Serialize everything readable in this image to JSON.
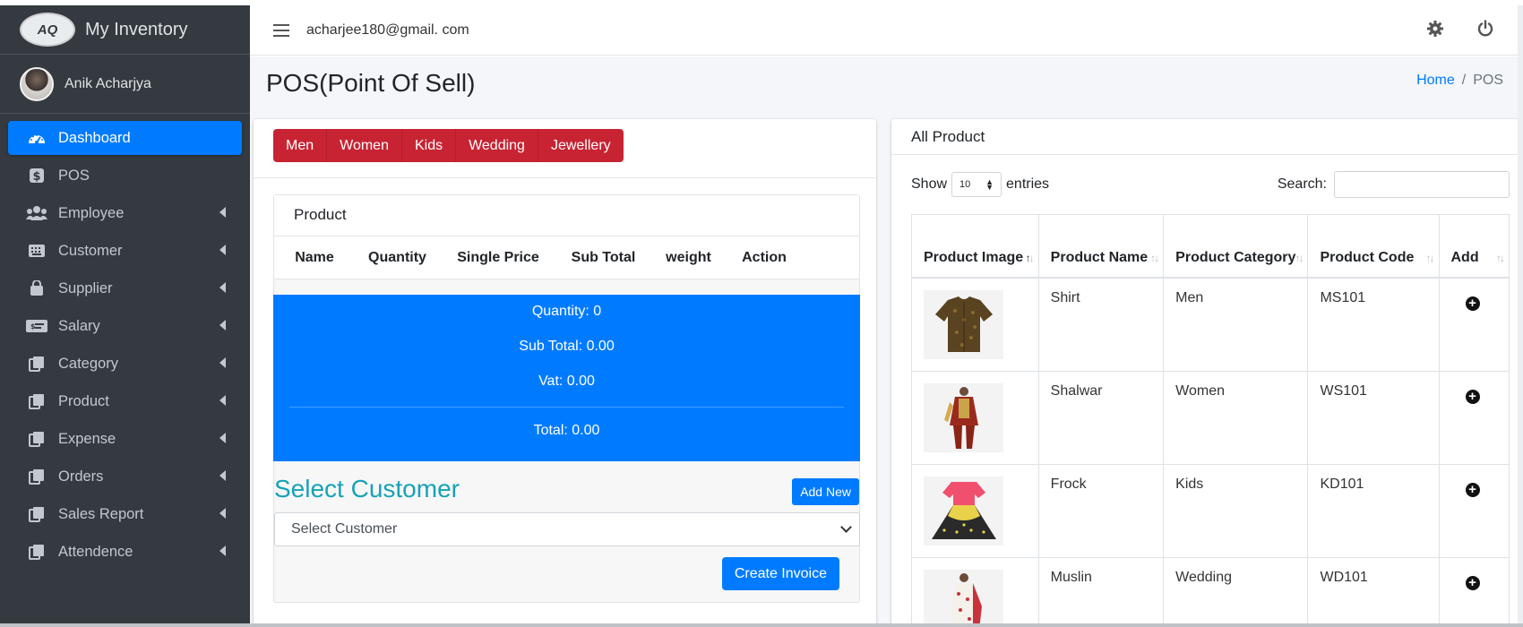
{
  "app": {
    "brand_name": "My Inventory",
    "brand_logo_text": "AQ"
  },
  "user": {
    "name": "Anik Acharjya"
  },
  "sidebar": {
    "items": [
      {
        "label": "Dashboard",
        "icon": "tachometer-icon",
        "active": true,
        "has_caret": false
      },
      {
        "label": "POS",
        "icon": "dollar-icon",
        "active": false,
        "has_caret": false
      },
      {
        "label": "Employee",
        "icon": "users-icon",
        "active": false,
        "has_caret": true
      },
      {
        "label": "Customer",
        "icon": "keyboard-icon",
        "active": false,
        "has_caret": true
      },
      {
        "label": "Supplier",
        "icon": "shopping-bag-icon",
        "active": false,
        "has_caret": true
      },
      {
        "label": "Salary",
        "icon": "money-bill-icon",
        "active": false,
        "has_caret": true
      },
      {
        "label": "Category",
        "icon": "copy-icon",
        "active": false,
        "has_caret": true
      },
      {
        "label": "Product",
        "icon": "copy-icon",
        "active": false,
        "has_caret": true
      },
      {
        "label": "Expense",
        "icon": "copy-icon",
        "active": false,
        "has_caret": true
      },
      {
        "label": "Orders",
        "icon": "copy-icon",
        "active": false,
        "has_caret": true
      },
      {
        "label": "Sales Report",
        "icon": "copy-icon",
        "active": false,
        "has_caret": true
      },
      {
        "label": "Attendence",
        "icon": "copy-icon",
        "active": false,
        "has_caret": true
      }
    ]
  },
  "topbar": {
    "email": "acharjee180@gmail. com",
    "icons": [
      "gear-icon",
      "power-icon"
    ]
  },
  "page": {
    "title": "POS(Point Of Sell)"
  },
  "breadcrumb": {
    "home": "Home",
    "separator": "/",
    "current": "POS"
  },
  "categories": [
    "Men",
    "Women",
    "Kids",
    "Wedding",
    "Jewellery"
  ],
  "cart": {
    "title": "Product",
    "columns": [
      "Name",
      "Quantity",
      "Single Price",
      "Sub Total",
      "weight",
      "Action"
    ],
    "summary": {
      "quantity": "Quantity: 0",
      "sub_total": "Sub Total: 0.00",
      "vat": "Vat: 0.00",
      "total": "Total: 0.00"
    }
  },
  "customer": {
    "heading": "Select Customer",
    "add_new_label": "Add New",
    "select_value": "Select Customer",
    "create_invoice_label": "Create Invoice"
  },
  "all_products": {
    "title": "All Product",
    "show_label": "Show",
    "entries_value": "10",
    "entries_label": "entries",
    "search_label": "Search:",
    "columns": [
      "Product Image",
      "Product Name",
      "Product Category",
      "Product Code",
      "Add"
    ],
    "rows": [
      {
        "name": "Shirt",
        "category": "Men",
        "code": "MS101"
      },
      {
        "name": "Shalwar",
        "category": "Women",
        "code": "WS101"
      },
      {
        "name": "Frock",
        "category": "Kids",
        "code": "KD101"
      },
      {
        "name": "Muslin",
        "category": "Wedding",
        "code": "WD101"
      }
    ]
  },
  "colors": {
    "sidebar_bg": "#343a40",
    "primary": "#007bff",
    "danger": "#c82333",
    "info": "#17a2b8",
    "content_bg": "#f4f6f9"
  }
}
